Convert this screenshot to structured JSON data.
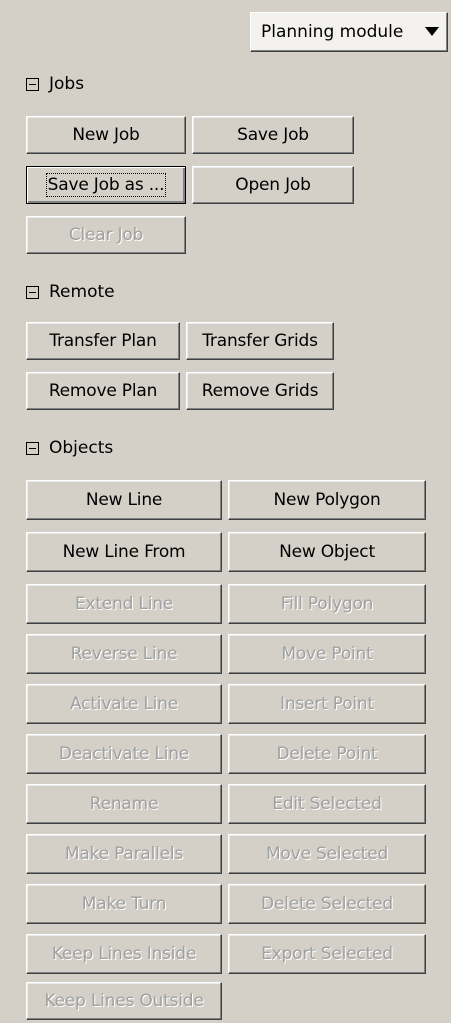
{
  "module_select": {
    "value": "Planning module"
  },
  "jobs": {
    "title": "Jobs",
    "new_job": "New Job",
    "save_job": "Save Job",
    "save_job_as": "Save Job as ...",
    "open_job": "Open Job",
    "clear_job": "Clear Job"
  },
  "remote": {
    "title": "Remote",
    "transfer_plan": "Transfer Plan",
    "transfer_grids": "Transfer Grids",
    "remove_plan": "Remove Plan",
    "remove_grids": "Remove Grids"
  },
  "objects": {
    "title": "Objects",
    "new_line": "New Line",
    "new_polygon": "New Polygon",
    "new_line_from": "New Line From",
    "new_object": "New Object",
    "extend_line": "Extend Line",
    "fill_polygon": "Fill Polygon",
    "reverse_line": "Reverse Line",
    "move_point": "Move Point",
    "activate_line": "Activate Line",
    "insert_point": "Insert Point",
    "deactivate_line": "Deactivate Line",
    "delete_point": "Delete Point",
    "rename": "Rename",
    "edit_selected": "Edit Selected",
    "make_parallels": "Make Parallels",
    "move_selected": "Move Selected",
    "make_turn": "Make Turn",
    "delete_selected": "Delete Selected",
    "keep_lines_inside": "Keep Lines Inside",
    "export_selected": "Export Selected",
    "keep_lines_outside": "Keep Lines Outside"
  }
}
